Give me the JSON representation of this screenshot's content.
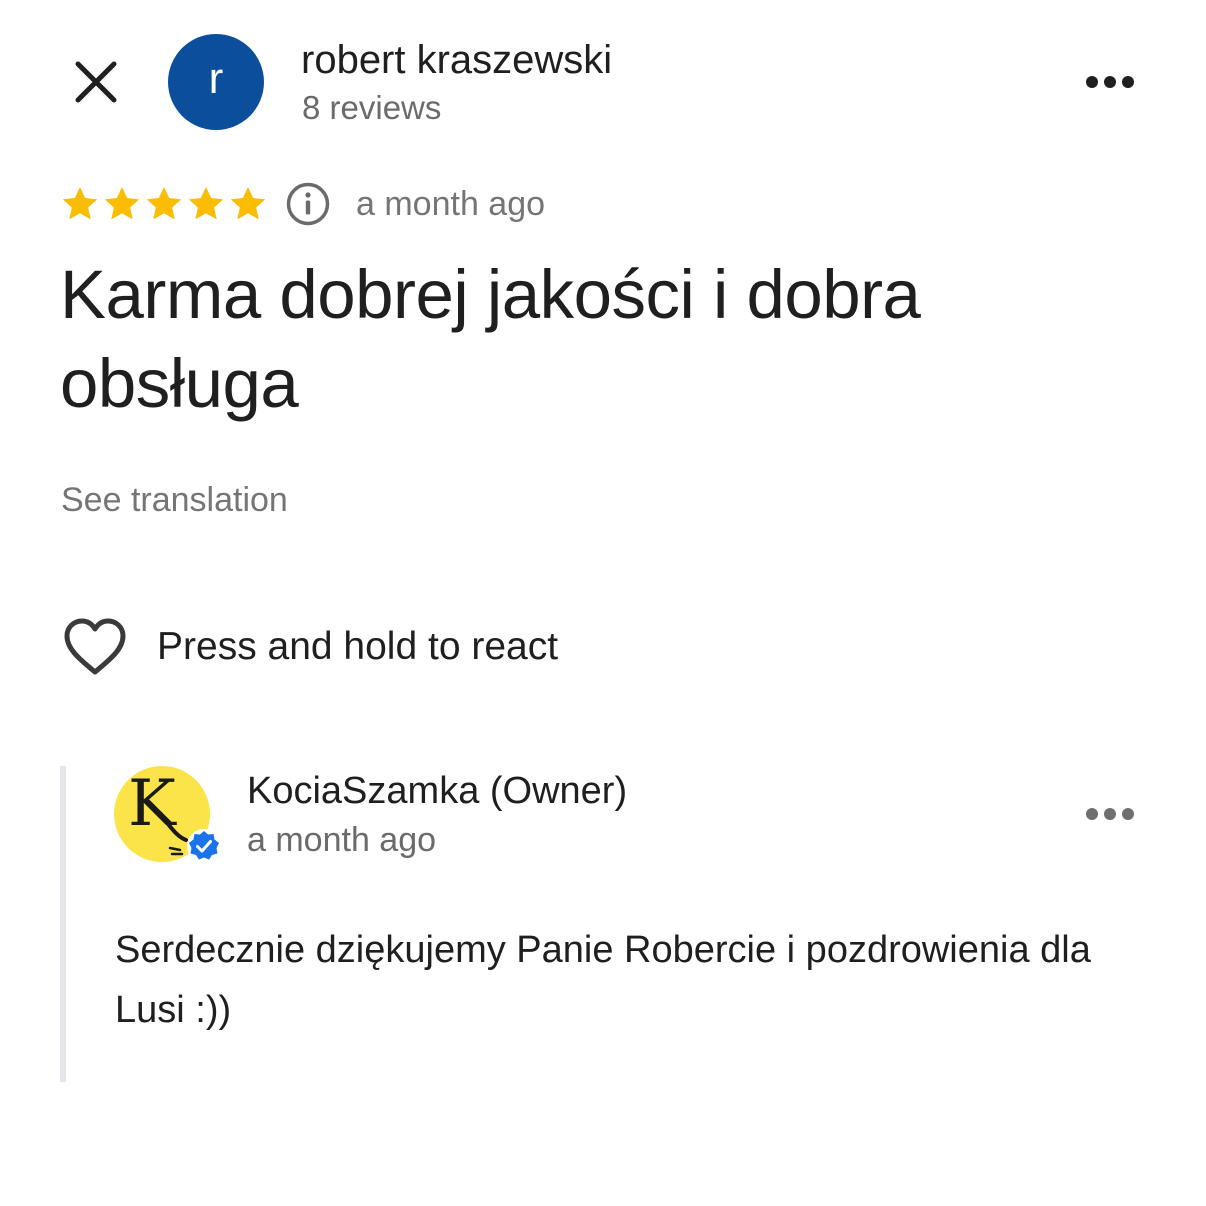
{
  "header": {
    "reviewer_initial": "r",
    "reviewer_name": "robert kraszewski",
    "reviewer_reviews": "8 reviews",
    "avatar_color": "#0a4e9c"
  },
  "review": {
    "rating": 5,
    "rating_max": 5,
    "star_color": "#fbbc04",
    "time": "a month ago",
    "title": "Karma dobrej jakości i dobra obsługa",
    "see_translation": "See translation",
    "react_label": "Press and hold to react"
  },
  "reply": {
    "owner_initial": "K",
    "owner_name": "KociaSzamka (Owner)",
    "owner_time": "a month ago",
    "text": "Serdecznie dziękujemy Panie Robercie i pozdrowienia dla Lusi :))",
    "avatar_color": "#fbe34a",
    "verified_color": "#1a73e8"
  },
  "icons": {
    "close": "close-icon",
    "more": "more-horizontal-icon",
    "info": "info-icon",
    "heart": "heart-outline-icon",
    "verified": "verified-badge-icon"
  }
}
